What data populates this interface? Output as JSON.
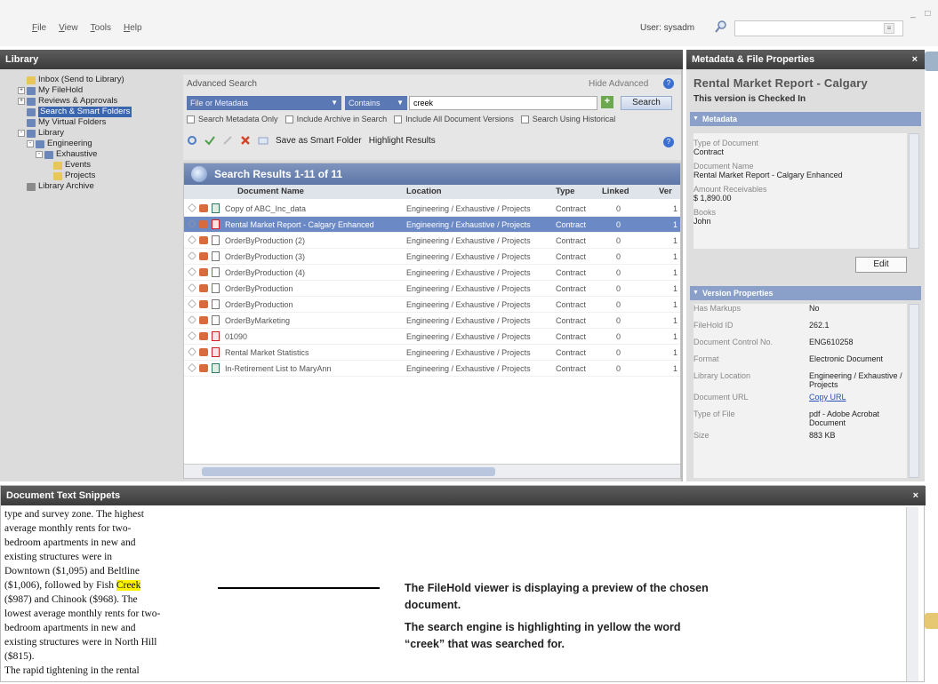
{
  "menu": [
    "File",
    "View",
    "Tools",
    "Help"
  ],
  "user": {
    "label": "User: sysadm",
    "search_placeholder": ""
  },
  "library": {
    "title": "Library",
    "tree": [
      {
        "label": "Inbox (Send to Library)",
        "indent": 1,
        "color": "#e9c65a",
        "pm": ""
      },
      {
        "label": "My FileHold",
        "indent": 0,
        "color": "#6b86b8",
        "pm": "+"
      },
      {
        "label": "Reviews & Approvals",
        "indent": 0,
        "color": "#6b86b8",
        "pm": "+"
      },
      {
        "label": "Search & Smart Folders",
        "indent": 1,
        "color": "#6b86b8",
        "pm": "",
        "selected": true
      },
      {
        "label": "My Virtual Folders",
        "indent": 1,
        "color": "#6b86b8",
        "pm": ""
      },
      {
        "label": "Library",
        "indent": 0,
        "color": "#6b86b8",
        "pm": "-"
      },
      {
        "label": "Engineering",
        "indent": 1,
        "color": "#6b86b8",
        "pm": "-"
      },
      {
        "label": "Exhaustive",
        "indent": 2,
        "color": "#6b86b8",
        "pm": "-"
      },
      {
        "label": "Events",
        "indent": 4,
        "color": "#e9c65a",
        "pm": ""
      },
      {
        "label": "Projects",
        "indent": 4,
        "color": "#e9c65a",
        "pm": ""
      },
      {
        "label": "Library Archive",
        "indent": 1,
        "color": "#8a8a8a",
        "pm": ""
      }
    ]
  },
  "search": {
    "title": "Advanced Search",
    "hide_label": "Hide Advanced",
    "field": "File or Metadata",
    "operator": "Contains",
    "term": "creek",
    "button": "Search",
    "checks": [
      "Search Metadata Only",
      "Include Archive in Search",
      "Include All Document Versions",
      "Search Using Historical"
    ],
    "save_smart": "Save as Smart Folder",
    "highlight": "Highlight Results"
  },
  "results": {
    "title": "Search Results 1-11 of 11",
    "columns": [
      "Document Name",
      "Location",
      "Type",
      "Linked",
      "Ver"
    ],
    "rows": [
      {
        "name": "Copy of ABC_Inc_data",
        "location": "Engineering / Exhaustive / Projects",
        "type": "Contract",
        "linked": "0",
        "ver": "1",
        "icon": "xls"
      },
      {
        "name": "Rental Market Report - Calgary Enhanced",
        "location": "Engineering / Exhaustive / Projects",
        "type": "Contract",
        "linked": "0",
        "ver": "1",
        "icon": "pdf",
        "selected": true
      },
      {
        "name": "OrderByProduction (2)",
        "location": "Engineering / Exhaustive / Projects",
        "type": "Contract",
        "linked": "0",
        "ver": "1",
        "icon": "doc"
      },
      {
        "name": "OrderByProduction (3)",
        "location": "Engineering / Exhaustive / Projects",
        "type": "Contract",
        "linked": "0",
        "ver": "1",
        "icon": "doc"
      },
      {
        "name": "OrderByProduction (4)",
        "location": "Engineering / Exhaustive / Projects",
        "type": "Contract",
        "linked": "0",
        "ver": "1",
        "icon": "doc"
      },
      {
        "name": "OrderByProduction",
        "location": "Engineering / Exhaustive / Projects",
        "type": "Contract",
        "linked": "0",
        "ver": "1",
        "icon": "doc"
      },
      {
        "name": "OrderByProduction",
        "location": "Engineering / Exhaustive / Projects",
        "type": "Contract",
        "linked": "0",
        "ver": "1",
        "icon": "doc"
      },
      {
        "name": "OrderByMarketing",
        "location": "Engineering / Exhaustive / Projects",
        "type": "Contract",
        "linked": "0",
        "ver": "1",
        "icon": "doc"
      },
      {
        "name": "01090",
        "location": "Engineering / Exhaustive / Projects",
        "type": "Contract",
        "linked": "0",
        "ver": "1",
        "icon": "pdf"
      },
      {
        "name": "Rental Market Statistics",
        "location": "Engineering / Exhaustive / Projects",
        "type": "Contract",
        "linked": "0",
        "ver": "1",
        "icon": "pdf"
      },
      {
        "name": "In-Retirement List to MaryAnn",
        "location": "Engineering / Exhaustive / Projects",
        "type": "Contract",
        "linked": "0",
        "ver": "1",
        "icon": "xls"
      }
    ]
  },
  "meta": {
    "panel_title": "Metadata & File Properties",
    "doc_title": "Rental Market Report - Calgary",
    "status": "This version is Checked In",
    "metadata_section": "Metadata",
    "fields": [
      {
        "label": "Type of Document",
        "value": "Contract"
      },
      {
        "label": "Document Name",
        "value": "Rental Market Report - Calgary Enhanced"
      },
      {
        "label": "Amount Receivables",
        "value": "$ 1,890.00"
      },
      {
        "label": "Books",
        "value": "John"
      }
    ],
    "edit_button": "Edit",
    "version_section": "Version Properties",
    "version_props": [
      {
        "label": "Has Markups",
        "value": "No"
      },
      {
        "label": "FileHold ID",
        "value": "262.1"
      },
      {
        "label": "Document Control No.",
        "value": "ENG610258"
      },
      {
        "label": "Format",
        "value": "Electronic Document"
      },
      {
        "label": "Library Location",
        "value": "Engineering / Exhaustive / Projects"
      },
      {
        "label": "Document URL",
        "value": "Copy URL",
        "link": true
      },
      {
        "label": "Type of File",
        "value": "pdf - Adobe Acrobat Document"
      },
      {
        "label": "Size",
        "value": "883 KB"
      }
    ]
  },
  "snippets": {
    "title": "Document Text Snippets",
    "text_before": "type and survey zone. The highest\naverage monthly rents for two-\nbedroom apartments in new and\nexisting structures were in\nDowntown ($1,095) and Beltline\n($1,006), followed by Fish ",
    "highlight": "Creek",
    "text_after": "\n($987) and Chinook ($968). The\nlowest average monthly rents for two-\nbedroom apartments in new and\nexisting structures were in North Hill\n($815).\nThe rapid tightening in the rental",
    "callout1": "The FileHold viewer is displaying a preview of the chosen\ndocument.",
    "callout2": "The search engine is highlighting in yellow the word\n“creek” that was searched for."
  }
}
